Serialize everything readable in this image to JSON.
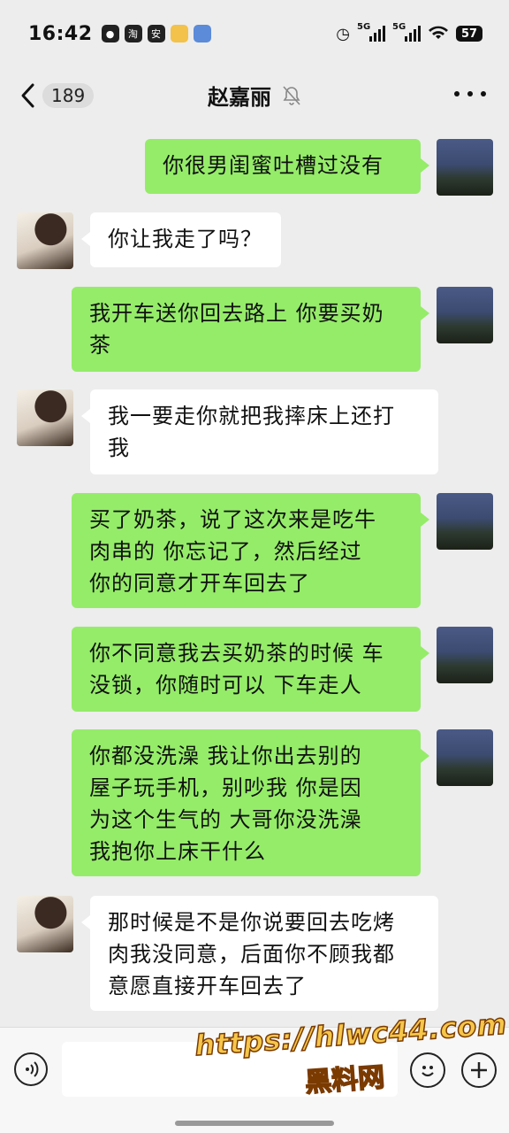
{
  "status_bar": {
    "time": "16:42",
    "network_1": "5G",
    "network_2": "5G",
    "battery": "57",
    "apps": [
      "淘",
      "安",
      "",
      ""
    ]
  },
  "nav": {
    "unread_count": "189",
    "title": "赵嘉丽"
  },
  "messages": [
    {
      "from": "me",
      "text": "你很男闺蜜吐槽过没有"
    },
    {
      "from": "her",
      "text": "你让我走了吗？"
    },
    {
      "from": "me",
      "lines": [
        "我开车送你回去路上 你要买奶",
        "茶"
      ]
    },
    {
      "from": "her",
      "lines": [
        "我一要走你就把我摔床上还打",
        "我"
      ]
    },
    {
      "from": "me",
      "lines": [
        "买了奶茶，说了这次来是吃牛",
        "肉串的  你忘记了，然后经过",
        "你的同意才开车回去了"
      ]
    },
    {
      "from": "me",
      "lines": [
        "你不同意我去买奶茶的时候 车",
        "没锁，你随时可以 下车走人"
      ]
    },
    {
      "from": "me",
      "lines": [
        "你都没洗澡  我让你出去别的",
        "屋子玩手机，别吵我  你是因",
        "为这个生气的  大哥你没洗澡",
        "我抱你上床干什么"
      ]
    },
    {
      "from": "her",
      "lines": [
        "那时候是不是你说要回去吃烤",
        "肉我没同意，后面你不顾我都",
        "意愿直接开车回去了"
      ]
    }
  ],
  "input_bar": {
    "placeholder": ""
  },
  "watermark": {
    "url": "https://hlwc44.com",
    "name": "黑料网"
  },
  "colors": {
    "sent_bubble": "#95ec69",
    "received_bubble": "#ffffff",
    "background": "#ededed"
  }
}
